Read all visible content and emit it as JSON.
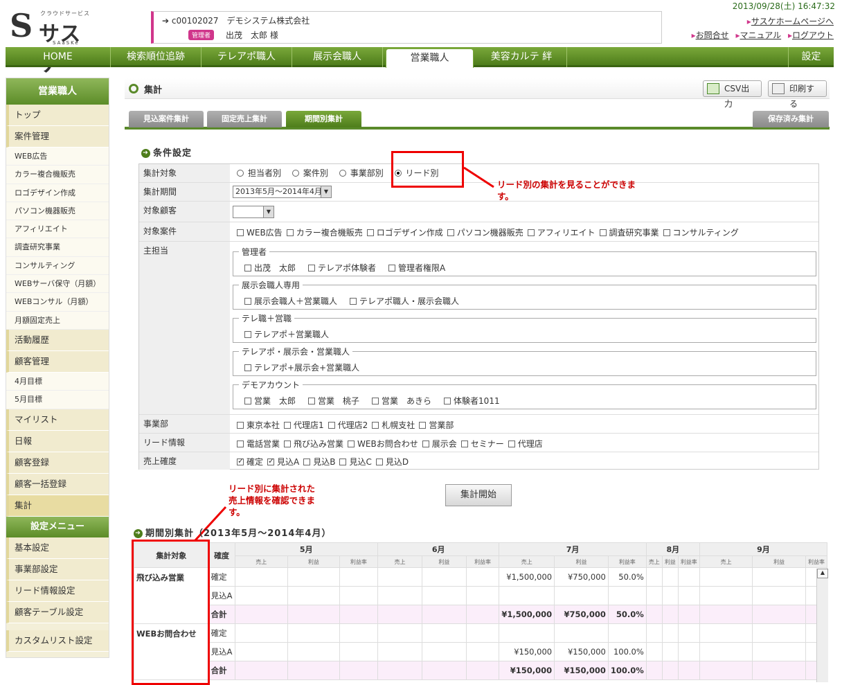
{
  "header": {
    "logo_sub": "クラウドサービス",
    "logo_main": "サスケ",
    "logo_en": "SAaSKe",
    "company_line": "c00102027　デモシステム株式会社",
    "role_badge": "管理者",
    "user_name": "出茂　太郎 様",
    "datetime": "2013/09/28(土) 16:47:32",
    "links": [
      "サスケホームページへ",
      "お問合せ",
      "マニュアル",
      "ログアウト"
    ]
  },
  "nav": {
    "items": [
      "HOME",
      "検索順位追跡",
      "テレアポ職人",
      "展示会職人",
      "営業職人",
      "美容カルテ 絆"
    ],
    "settings": "設定"
  },
  "sidebar": {
    "title": "営業職人",
    "items": [
      {
        "label": "トップ",
        "type": "m"
      },
      {
        "label": "案件管理",
        "type": "m"
      },
      {
        "label": "WEB広告",
        "type": "s"
      },
      {
        "label": "カラー複合機販売",
        "type": "s"
      },
      {
        "label": "ロゴデザイン作成",
        "type": "s"
      },
      {
        "label": "パソコン機器販売",
        "type": "s"
      },
      {
        "label": "アフィリエイト",
        "type": "s"
      },
      {
        "label": "調査研究事業",
        "type": "s"
      },
      {
        "label": "コンサルティング",
        "type": "s"
      },
      {
        "label": "WEBサーバ保守（月額）",
        "type": "s"
      },
      {
        "label": "WEBコンサル（月額）",
        "type": "s"
      },
      {
        "label": "月額固定売上",
        "type": "s"
      },
      {
        "label": "活動履歴",
        "type": "m"
      },
      {
        "label": "顧客管理",
        "type": "m"
      },
      {
        "label": "4月目標",
        "type": "s"
      },
      {
        "label": "5月目標",
        "type": "s"
      },
      {
        "label": "マイリスト",
        "type": "m"
      },
      {
        "label": "日報",
        "type": "m"
      },
      {
        "label": "顧客登録",
        "type": "m"
      },
      {
        "label": "顧客一括登録",
        "type": "m"
      },
      {
        "label": "集計",
        "type": "m"
      }
    ],
    "settings_title": "設定メニュー",
    "settings_items": [
      "基本設定",
      "事業部設定",
      "リード情報設定",
      "顧客テーブル設定",
      "カスタムリスト設定"
    ]
  },
  "page": {
    "title": "集計",
    "csv": "CSV出力",
    "print": "印刷する"
  },
  "tabs": [
    "見込案件集計",
    "固定売上集計",
    "期間別集計"
  ],
  "saved_tab": "保存済み集計",
  "cond": {
    "heading": "条件設定",
    "target_label": "集計対象",
    "target_opts": [
      "担当者別",
      "案件別",
      "事業部別",
      "リード別"
    ],
    "period_label": "集計期間",
    "period_value": "2013年5月～2014年4月",
    "customer_label": "対象顧客",
    "case_label": "対象案件",
    "cases": [
      "WEB広告",
      "カラー複合機販売",
      "ロゴデザイン作成",
      "パソコン機器販売",
      "アフィリエイト",
      "調査研究事業",
      "コンサルティング"
    ],
    "staff_label": "主担当",
    "groups": [
      {
        "name": "管理者",
        "members": [
          "出茂　太郎",
          "テレアポ体験者",
          "管理者権限A"
        ]
      },
      {
        "name": "展示会職人専用",
        "members": [
          "展示会職人＋営業職人",
          "テレアポ職人・展示会職人"
        ]
      },
      {
        "name": "テレ職＋営職",
        "members": [
          "テレアポ＋営業職人"
        ]
      },
      {
        "name": "テレアポ・展示会・営業職人",
        "members": [
          "テレアポ+展示会+営業職人"
        ]
      },
      {
        "name": "デモアカウント",
        "members": [
          "営業　太郎",
          "営業　桃子",
          "営業　あきら",
          "体験者1011"
        ]
      }
    ],
    "dept_label": "事業部",
    "depts": [
      "東京本社",
      "代理店1",
      "代理店2",
      "札幌支社",
      "営業部"
    ],
    "lead_label": "リード情報",
    "leads": [
      "電話営業",
      "飛び込み営業",
      "WEBお問合わせ",
      "展示会",
      "セミナー",
      "代理店"
    ],
    "cert_label": "売上確度",
    "certs": [
      "確定",
      "見込A",
      "見込B",
      "見込C",
      "見込D"
    ]
  },
  "notes": {
    "n1": "リード別の集計を見ることができます。",
    "n2": "リード別に集計された売上情報を確認できます。"
  },
  "start_button": "集計開始",
  "result": {
    "heading": "期間別集計（2013年5月～2014年4月）",
    "col_target": "集計対象",
    "col_cert": "確度",
    "months": [
      "5月",
      "6月",
      "7月",
      "8月",
      "9月"
    ],
    "sub": [
      "売上",
      "利益",
      "利益率"
    ],
    "rows": [
      {
        "group": "飛び込み営業",
        "cert": "確定",
        "jul": [
          "¥1,500,000",
          "¥750,000",
          "50.0%"
        ]
      },
      {
        "group": "",
        "cert": "見込A",
        "jul": [
          "",
          "",
          ""
        ]
      },
      {
        "group": "",
        "cert": "合計",
        "jul": [
          "¥1,500,000",
          "¥750,000",
          "50.0%"
        ],
        "sum": true
      },
      {
        "group": "WEBお問合わせ",
        "cert": "確定",
        "jul": [
          "",
          "",
          ""
        ]
      },
      {
        "group": "",
        "cert": "見込A",
        "jul": [
          "¥150,000",
          "¥150,000",
          "100.0%"
        ]
      },
      {
        "group": "",
        "cert": "合計",
        "jul": [
          "¥150,000",
          "¥150,000",
          "100.0%"
        ],
        "sum": true
      }
    ]
  }
}
